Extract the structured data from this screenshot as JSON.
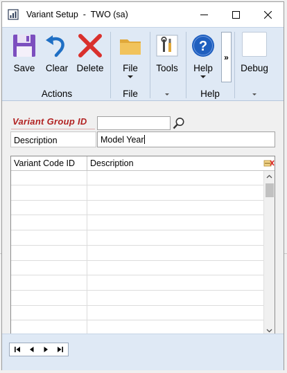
{
  "window": {
    "title": "Variant Setup  -  TWO (sa)",
    "controls": [
      "minimize-icon",
      "maximize-icon",
      "close-icon"
    ]
  },
  "ribbon": {
    "buttons": {
      "save": {
        "label": "Save",
        "icon": "save-icon"
      },
      "clear": {
        "label": "Clear",
        "icon": "undo-icon"
      },
      "delete": {
        "label": "Delete",
        "icon": "delete-x-icon"
      },
      "file": {
        "label": "File",
        "icon": "folder-icon"
      },
      "tools": {
        "label": "Tools",
        "icon": "tools-icon"
      },
      "help": {
        "label": "Help",
        "icon": "help-icon"
      },
      "debug": {
        "label": "Debug",
        "icon": "debug-icon"
      }
    },
    "overflow_label": "»",
    "groups": {
      "actions": "Actions",
      "file": "File",
      "help": "Help"
    }
  },
  "form": {
    "variant_group_id": {
      "label": "Variant Group ID",
      "value": ""
    },
    "description": {
      "label": "Description",
      "value": "Model Year"
    }
  },
  "grid": {
    "columns": [
      "Variant Code ID",
      "Description"
    ],
    "rows": [
      {
        "code": "",
        "description": ""
      },
      {
        "code": "",
        "description": ""
      },
      {
        "code": "",
        "description": ""
      },
      {
        "code": "",
        "description": ""
      },
      {
        "code": "",
        "description": ""
      },
      {
        "code": "",
        "description": ""
      },
      {
        "code": "",
        "description": ""
      },
      {
        "code": "",
        "description": ""
      },
      {
        "code": "",
        "description": ""
      },
      {
        "code": "",
        "description": ""
      },
      {
        "code": "",
        "description": ""
      },
      {
        "code": "",
        "description": ""
      }
    ]
  },
  "navigation": [
    "first-record-icon",
    "previous-record-icon",
    "next-record-icon",
    "last-record-icon"
  ],
  "colors": {
    "ribbon": "#dfe9f5",
    "required_label": "#b22222",
    "help_blue": "#1f5fbf",
    "delete_red": "#d9302c",
    "save_purple": "#7c4fbf"
  }
}
